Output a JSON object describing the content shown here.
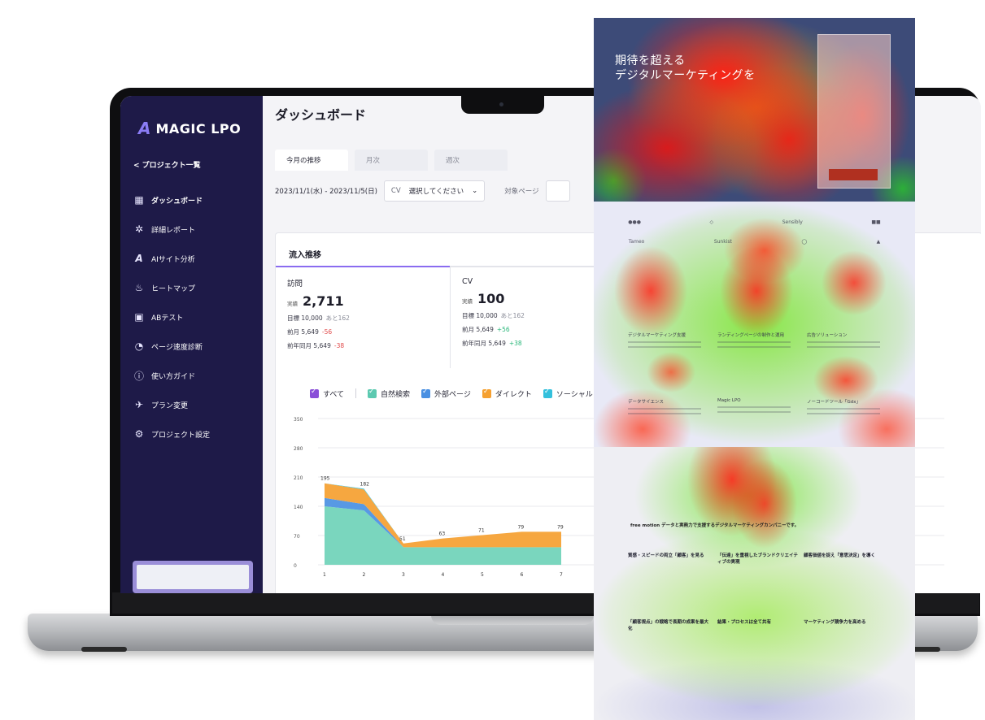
{
  "app": {
    "logo_text": "MAGIC LPO",
    "back_link": "< プロジェクト一覧",
    "nav": [
      {
        "label": "ダッシュボード",
        "icon": "grid-icon"
      },
      {
        "label": "詳細レポート",
        "icon": "sparkle-icon"
      },
      {
        "label": "AIサイト分析",
        "icon": "ai-icon"
      },
      {
        "label": "ヒートマップ",
        "icon": "flame-icon"
      },
      {
        "label": "ABテスト",
        "icon": "ab-test-icon"
      },
      {
        "label": "ページ速度診断",
        "icon": "speed-gauge-icon"
      },
      {
        "label": "使い方ガイド",
        "icon": "help-icon"
      },
      {
        "label": "プラン変更",
        "icon": "plane-icon"
      },
      {
        "label": "プロジェクト設定",
        "icon": "gear-icon"
      }
    ],
    "page_title": "ダッシュボード",
    "tabs": [
      "今月の推移",
      "月次",
      "週次"
    ],
    "filters": {
      "date_range": "2023/11/1(水) - 2023/11/5(日)",
      "cv_label": "CV",
      "cv_select": "選択してください",
      "target_label": "対象ページ"
    },
    "panel_title": "流入推移",
    "metrics": {
      "visits": {
        "title": "訪問",
        "actual_label": "実績",
        "actual": "2,711",
        "goal": "目標 10,000",
        "goal_remaining": "あと162",
        "prev_month": "前月 5,649",
        "prev_month_diff": "-56",
        "prev_year": "前年同月 5,649",
        "prev_year_diff": "-38"
      },
      "cv": {
        "title": "CV",
        "actual_label": "実績",
        "actual": "100",
        "goal": "目標 10,000",
        "goal_remaining": "あと162",
        "prev_month": "前月 5,649",
        "prev_month_diff": "+56",
        "prev_year": "前年同月 5,649",
        "prev_year_diff": "+38"
      }
    },
    "legend": [
      {
        "label": "すべて",
        "color": "#8a4fd8"
      },
      {
        "label": "自然検索",
        "color": "#5cc9b0"
      },
      {
        "label": "外部ページ",
        "color": "#4a90e2"
      },
      {
        "label": "ダイレクト",
        "color": "#f5a030"
      },
      {
        "label": "ソーシャル",
        "color": "#34c0dc"
      }
    ]
  },
  "chart_data": {
    "type": "area",
    "x": [
      1,
      2,
      3,
      4,
      5,
      6,
      7
    ],
    "yticks": [
      0,
      70,
      140,
      210,
      280,
      350
    ],
    "ylim": [
      0,
      350
    ],
    "total_labels": [
      195,
      182,
      51,
      63,
      71,
      79,
      79
    ],
    "series": [
      {
        "name": "自然検索",
        "color": "#6fd3b8",
        "values": [
          140,
          130,
          42,
          42,
          42,
          42,
          42
        ]
      },
      {
        "name": "外部ページ",
        "color": "#4a90e2",
        "values": [
          20,
          15,
          0,
          0,
          0,
          0,
          0
        ]
      },
      {
        "name": "ダイレクト",
        "color": "#f5a030",
        "values": [
          35,
          35,
          9,
          21,
          29,
          37,
          37
        ]
      },
      {
        "name": "ソーシャル",
        "color": "#34c0dc",
        "values": [
          0,
          2,
          0,
          0,
          0,
          0,
          0
        ]
      }
    ]
  },
  "heatmap": {
    "hero_title_1": "期待を超える",
    "hero_title_2": "デジタルマーケティングを",
    "services": [
      "デジタルマーケティング支援",
      "ランディングページの制作と運用",
      "広告ソリューション",
      "データサイエンス",
      "Magic LPO",
      "ノーコードツール「Gdx」"
    ],
    "about_title": "free motion データと実務力で支援するデジタルマーケティングカンパニーです。",
    "about_cards": [
      "質感・スピードの両立「顧客」を見る",
      "「伝達」を重視したブランドクリエイティブの実現",
      "顧客価値を捉え「意思決定」を導く",
      "「顧客視点」の戦略で長期の成果を最大化",
      "結果・プロセスは全て共有",
      "マーケティング競争力を高める"
    ],
    "logos": [
      "Tameo",
      "Sensibly",
      "Sunkist"
    ]
  }
}
